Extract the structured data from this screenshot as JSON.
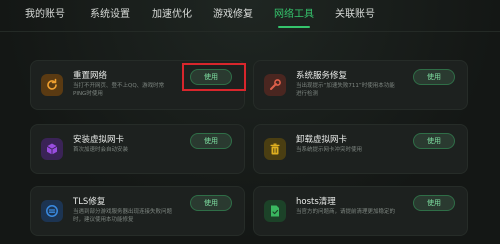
{
  "nav": {
    "tabs": [
      {
        "label": "我的账号",
        "active": false
      },
      {
        "label": "系统设置",
        "active": false
      },
      {
        "label": "加速优化",
        "active": false
      },
      {
        "label": "游戏修复",
        "active": false
      },
      {
        "label": "网络工具",
        "active": true
      },
      {
        "label": "关联账号",
        "active": false
      }
    ],
    "accent_color": "#35c46c"
  },
  "tools": [
    {
      "title": "重置网络",
      "desc": "当打不开网页、登不上QQ、游戏时常PING时使用",
      "button": "使用",
      "icon": "reset-network-icon",
      "icon_color": "#f0a030",
      "highlighted": true
    },
    {
      "title": "系统服务修复",
      "desc": "当出现提示“加速失败711”时使用本功能进行检测",
      "button": "使用",
      "icon": "wrench-icon",
      "icon_color": "#e0604a",
      "highlighted": false
    },
    {
      "title": "安装虚拟网卡",
      "desc": "首次加速时会自动安装",
      "button": "使用",
      "icon": "cube-icon",
      "icon_color": "#9a4de0",
      "highlighted": false
    },
    {
      "title": "卸载虚拟网卡",
      "desc": "当系统提示网卡冲突时使用",
      "button": "使用",
      "icon": "trash-icon",
      "icon_color": "#e0b020",
      "highlighted": false
    },
    {
      "title": "TLS修复",
      "desc": "当遇到部分游戏服务器出现连接失败问题时，建议使用本功能修复",
      "button": "使用",
      "icon": "tls-icon",
      "icon_color": "#3a8ae0",
      "highlighted": false
    },
    {
      "title": "hosts清理",
      "desc": "当官方的问题商，请提前清理更加稳定的",
      "button": "使用",
      "icon": "document-check-icon",
      "icon_color": "#3ab860",
      "highlighted": false
    }
  ]
}
